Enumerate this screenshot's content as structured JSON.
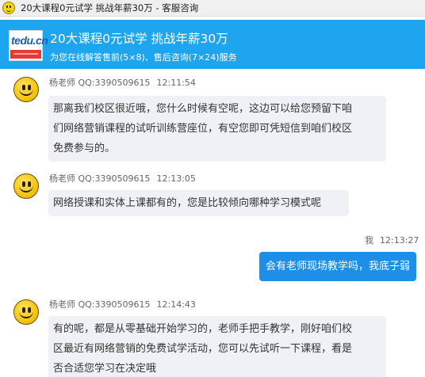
{
  "window": {
    "title": "20大课程0元试学 挑战年薪30万 - 客服咨询"
  },
  "header": {
    "logo_text": "tedu.cn",
    "title": "20大课程0元试学 挑战年薪30万",
    "subtitle": "为您在线解答售前(5×8)、售后咨询(7×24)服务"
  },
  "messages": [
    {
      "sender": "杨老师 QQ:3390509615",
      "time": "12:11:54",
      "lines": [
        "那离我们校区很近哦，您什么时候有空呢，这边可以给您预留下咱",
        "们网络营销课程的试听训练营座位，有空您即可凭短信到咱们校区",
        "免费参与的。"
      ]
    },
    {
      "sender": "杨老师 QQ:3390509615",
      "time": "12:13:05",
      "lines": [
        "网络授课和实体上课都有的，您是比较倾向哪种学习模式呢"
      ]
    },
    {
      "sender": "我",
      "time": "12:13:27",
      "lines": [
        "会有老师现场教学吗，我底子弱"
      ]
    },
    {
      "sender": "杨老师 QQ:3390509615",
      "time": "12:14:43",
      "lines": [
        "有的呢，都是从零基础开始学习的，老师手把手教学，刚好咱们校",
        "区最近有网络营销的免费试学活动，您可以先试听一下课程，看是",
        "否合适您学习在决定哦"
      ]
    }
  ]
}
